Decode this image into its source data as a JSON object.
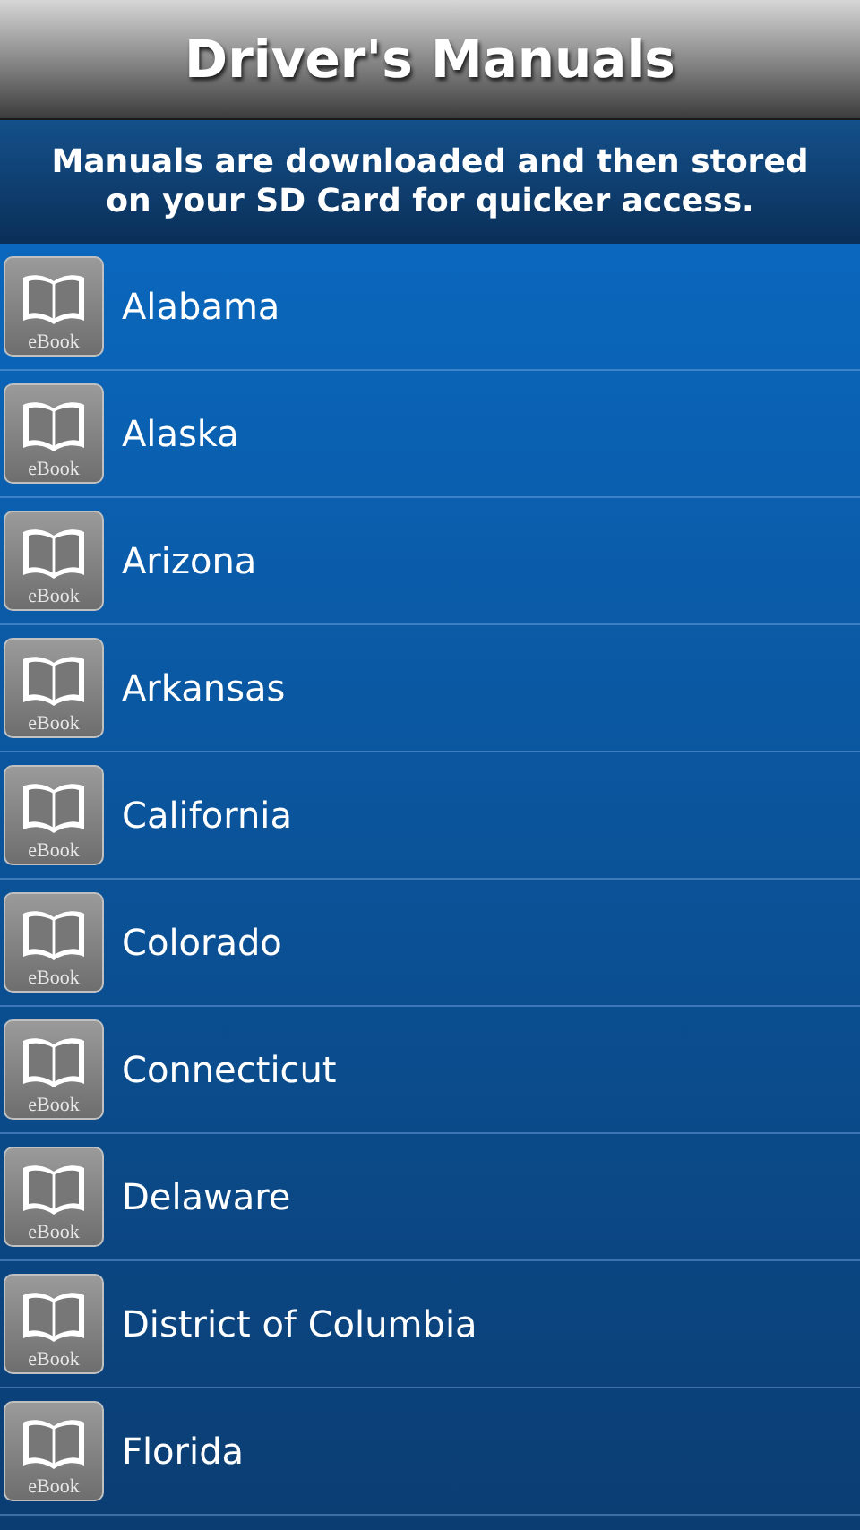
{
  "title": "Driver's Manuals",
  "subtitle": "Manuals are downloaded and then stored on your SD Card for quicker access.",
  "manuals": [
    {
      "name": "Alabama",
      "badge": "eBook"
    },
    {
      "name": "Alaska",
      "badge": "eBook"
    },
    {
      "name": "Arizona",
      "badge": "eBook"
    },
    {
      "name": "Arkansas",
      "badge": "eBook"
    },
    {
      "name": "California",
      "badge": "eBook"
    },
    {
      "name": "Colorado",
      "badge": "eBook"
    },
    {
      "name": "Connecticut",
      "badge": "eBook"
    },
    {
      "name": "Delaware",
      "badge": "eBook"
    },
    {
      "name": "District of Columbia",
      "badge": "eBook"
    },
    {
      "name": "Florida",
      "badge": "eBook"
    }
  ]
}
